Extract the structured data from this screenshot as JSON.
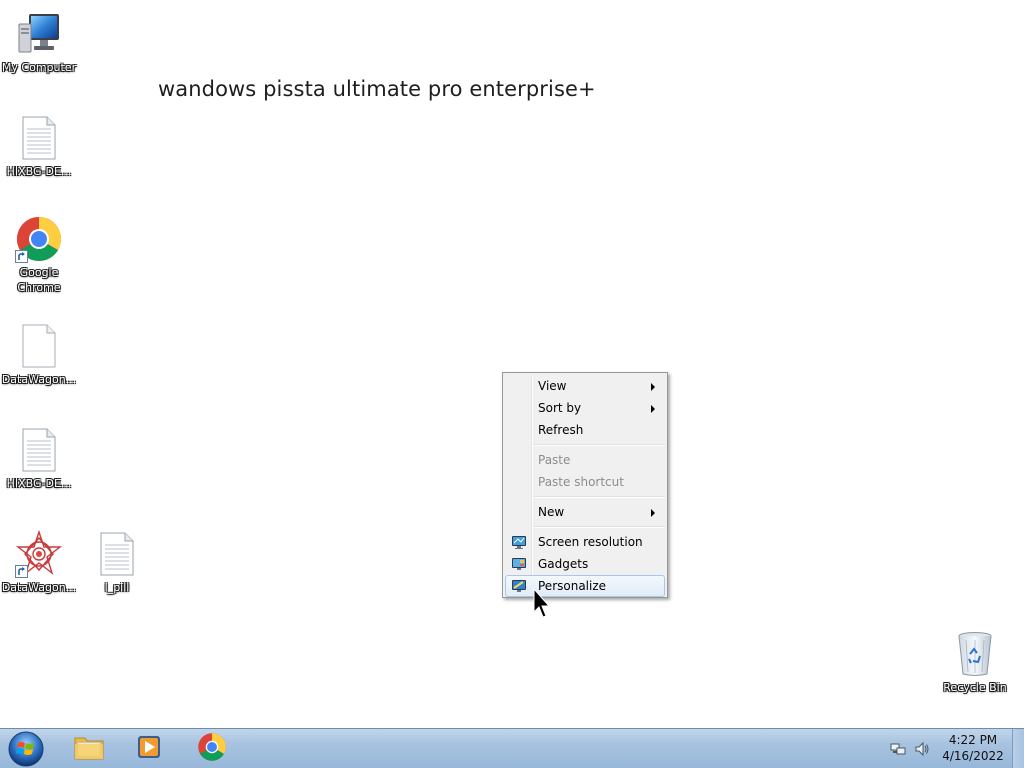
{
  "desktop": {
    "watermark": "wandows pissta ultimate pro enterprise+",
    "icons": [
      {
        "label": "My Computer",
        "icon": "computer-icon"
      },
      {
        "label": "HIXBG-DE...",
        "icon": "text-document-icon"
      },
      {
        "label": "Google Chrome",
        "icon": "chrome-icon"
      },
      {
        "label": "DataWagon...",
        "icon": "blank-document-icon"
      },
      {
        "label": "HIXBG-DE...",
        "icon": "text-document-icon"
      },
      {
        "label": "DataWagon...",
        "icon": "mandala-icon"
      },
      {
        "label": "l_pill",
        "icon": "text-document-icon"
      },
      {
        "label": "Recycle Bin",
        "icon": "recycle-bin-icon"
      }
    ]
  },
  "context_menu": {
    "items": [
      {
        "label": "View",
        "submenu": true,
        "enabled": true
      },
      {
        "label": "Sort by",
        "submenu": true,
        "enabled": true
      },
      {
        "label": "Refresh",
        "submenu": false,
        "enabled": true
      },
      {
        "label": "Paste",
        "submenu": false,
        "enabled": false
      },
      {
        "label": "Paste shortcut",
        "submenu": false,
        "enabled": false
      },
      {
        "label": "New",
        "submenu": true,
        "enabled": true
      },
      {
        "label": "Screen resolution",
        "submenu": false,
        "enabled": true,
        "icon": "display-icon"
      },
      {
        "label": "Gadgets",
        "submenu": false,
        "enabled": true,
        "icon": "gadgets-icon"
      },
      {
        "label": "Personalize",
        "submenu": false,
        "enabled": true,
        "icon": "personalize-icon",
        "highlighted": true
      }
    ]
  },
  "taskbar": {
    "pinned": [
      {
        "name": "Windows Explorer",
        "icon": "folder-icon"
      },
      {
        "name": "Windows Media Player",
        "icon": "media-player-icon"
      },
      {
        "name": "Google Chrome",
        "icon": "chrome-icon"
      }
    ],
    "tray": {
      "time": "4:22 PM",
      "date": "4/16/2022"
    }
  },
  "colors": {
    "taskbar_top": "#c2d6ea",
    "taskbar_bottom": "#98b8da",
    "menu_background": "#f0f0f0",
    "menu_highlight_border": "#a9c7e8"
  }
}
